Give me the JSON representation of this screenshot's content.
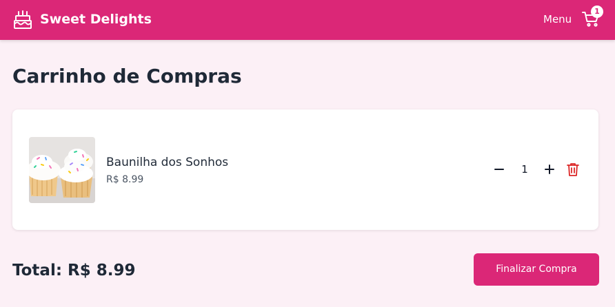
{
  "header": {
    "brand_name": "Sweet Delights",
    "brand_icon": "cake-icon",
    "menu_label": "Menu",
    "cart_icon": "shopping-cart-icon",
    "cart_count": "1"
  },
  "page": {
    "title": "Carrinho de Compras"
  },
  "cart": {
    "items": [
      {
        "name": "Baunilha dos Sonhos",
        "price": "R$ 8.99",
        "quantity": "1",
        "image": "vanilla-cupcakes-photo"
      }
    ]
  },
  "summary": {
    "total_text": "Total: R$ 8.99",
    "checkout_label": "Finalizar Compra"
  },
  "colors": {
    "brand": "#db2777",
    "background": "#fcf0f6",
    "delete": "#dc2626",
    "text": "#1f2937"
  }
}
